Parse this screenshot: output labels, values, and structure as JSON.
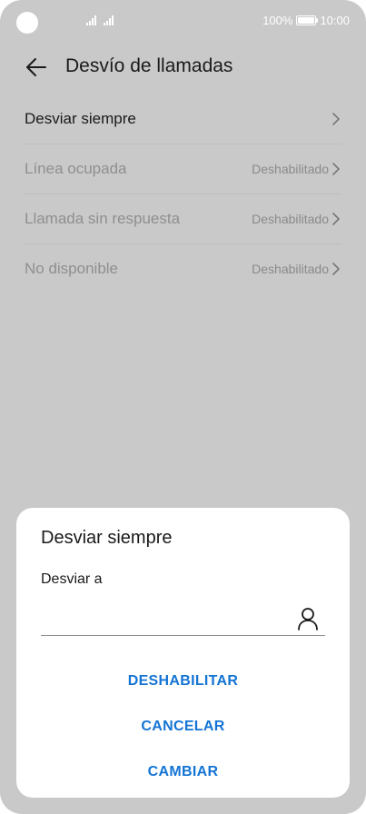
{
  "status_bar": {
    "battery_text": "100%",
    "time": "10:00",
    "icons": [
      "camera-cutout",
      "signal-icon",
      "signal-icon",
      "battery-icon"
    ]
  },
  "header": {
    "title": "Desvío de llamadas",
    "back_icon": "arrow-left-icon"
  },
  "list": {
    "items": [
      {
        "label": "Desviar siempre",
        "value": "",
        "enabled": true
      },
      {
        "label": "Línea ocupada",
        "value": "Deshabilitado",
        "enabled": false
      },
      {
        "label": "Llamada sin respuesta",
        "value": "Deshabilitado",
        "enabled": false
      },
      {
        "label": "No disponible",
        "value": "Deshabilitado",
        "enabled": false
      }
    ]
  },
  "dialog": {
    "title": "Desviar siempre",
    "field_label": "Desviar a",
    "field_value": "",
    "contact_icon": "person-icon",
    "buttons": {
      "disable": "DESHABILITAR",
      "cancel": "CANCELAR",
      "change": "CAMBIAR"
    }
  },
  "colors": {
    "accent": "#1474d4",
    "overlay_background": "#c9c9c9",
    "dialog_background": "#ffffff"
  }
}
